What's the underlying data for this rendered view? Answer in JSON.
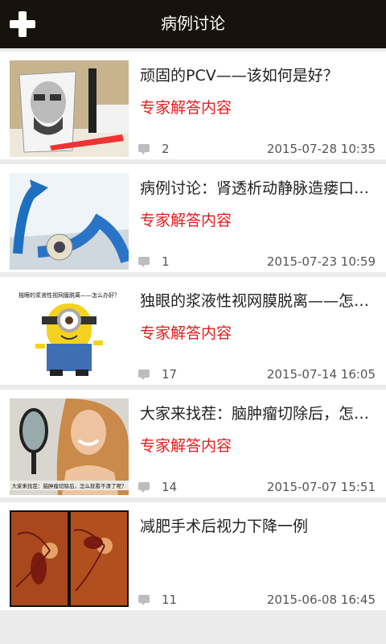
{
  "header": {
    "title": "病例讨论",
    "add_icon": "plus-icon"
  },
  "posts": [
    {
      "title": "顽固的PCV——该如何是好？",
      "subtitle": "专家解答内容",
      "comments": "2",
      "date": "2015-07-28 10:35",
      "thumb": "cup-face"
    },
    {
      "title": "病例讨论：肾透析动静脉造瘘口…",
      "subtitle": "专家解答内容",
      "comments": "1",
      "date": "2015-07-23 10:59",
      "thumb": "arrow-eye"
    },
    {
      "title": "独眼的浆液性视网膜脱离——怎…",
      "subtitle": "专家解答内容",
      "comments": "17",
      "date": "2015-07-14 16:05",
      "thumb": "minion",
      "thumb_caption": "独眼的浆液性视网膜脱离——怎么办好？"
    },
    {
      "title": "大家来找茬：脑肿瘤切除后，怎…",
      "subtitle": "专家解答内容",
      "comments": "14",
      "date": "2015-07-07 15:51",
      "thumb": "woman-mirror",
      "thumb_caption": "大家来找茬：脑肿瘤切除后，怎么就看不清了呢？"
    },
    {
      "title": "减肥手术后视力下降一例",
      "subtitle": "",
      "comments": "11",
      "date": "2015-06-08 16:45",
      "thumb": "fundus"
    }
  ]
}
